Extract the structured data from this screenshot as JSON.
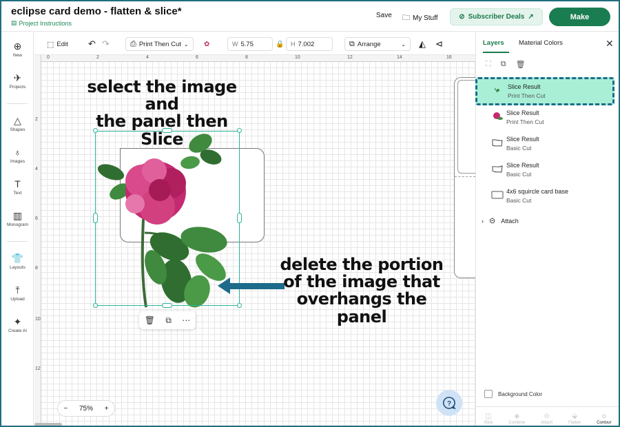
{
  "header": {
    "title": "eclipse card demo - flatten & slice*",
    "project_instructions": "Project Instructions",
    "save": "Save",
    "my_stuff": "My Stuff",
    "subscriber_deals": "Subscriber Deals",
    "make": "Make"
  },
  "sidebar": {
    "items": [
      {
        "label": "New",
        "icon": "plus-circle-icon"
      },
      {
        "label": "Projects",
        "icon": "rocket-icon"
      },
      {
        "label": "Shapes",
        "icon": "shapes-icon"
      },
      {
        "label": "Images",
        "icon": "bulb-icon"
      },
      {
        "label": "Text",
        "icon": "text-icon"
      },
      {
        "label": "Monogram",
        "icon": "monogram-icon"
      },
      {
        "label": "Layouts",
        "icon": "shirt-icon"
      },
      {
        "label": "Upload",
        "icon": "upload-icon"
      },
      {
        "label": "Create AI",
        "icon": "sparkle-icon"
      }
    ]
  },
  "toolbar": {
    "edit": "Edit",
    "operation": "Print Then Cut",
    "w_label": "W",
    "w_value": "5.75",
    "h_label": "H",
    "h_value": "7.002",
    "arrange": "Arrange"
  },
  "rulers": {
    "top": [
      "0",
      "2",
      "4",
      "6",
      "8",
      "10",
      "12",
      "14",
      "16"
    ],
    "left": [
      "2",
      "4",
      "6",
      "8",
      "10",
      "12"
    ]
  },
  "canvas": {
    "callout_top_line1": "select the image and",
    "callout_top_line2": "the panel then Slice",
    "callout_bottom_line1": "delete the portion",
    "callout_bottom_line2": "of the image that",
    "callout_bottom_line3": "overhangs the panel",
    "zoom_level": "75%",
    "zoom_minus": "−",
    "zoom_plus": "+"
  },
  "right_panel": {
    "tabs": [
      "Layers",
      "Material Colors"
    ],
    "layers": [
      {
        "name": "Slice Result",
        "type": "Print Then Cut",
        "selected": true
      },
      {
        "name": "Slice Result",
        "type": "Print Then Cut",
        "selected": false
      },
      {
        "name": "Slice Result",
        "type": "Basic Cut",
        "selected": false
      },
      {
        "name": "Slice Result",
        "type": "Basic Cut",
        "selected": false
      },
      {
        "name": "4x6 squircle card base",
        "type": "Basic Cut",
        "selected": false
      }
    ],
    "attach": "Attach",
    "background_color": "Background Color",
    "bottom_tools": [
      "Slice",
      "Combine",
      "Attach",
      "Flatten",
      "Contour"
    ]
  },
  "colors": {
    "accent": "#1a7d52",
    "selection": "#2bb39a",
    "highlight": "#a8efd6",
    "annotation_arrow": "#1d6b8a"
  }
}
